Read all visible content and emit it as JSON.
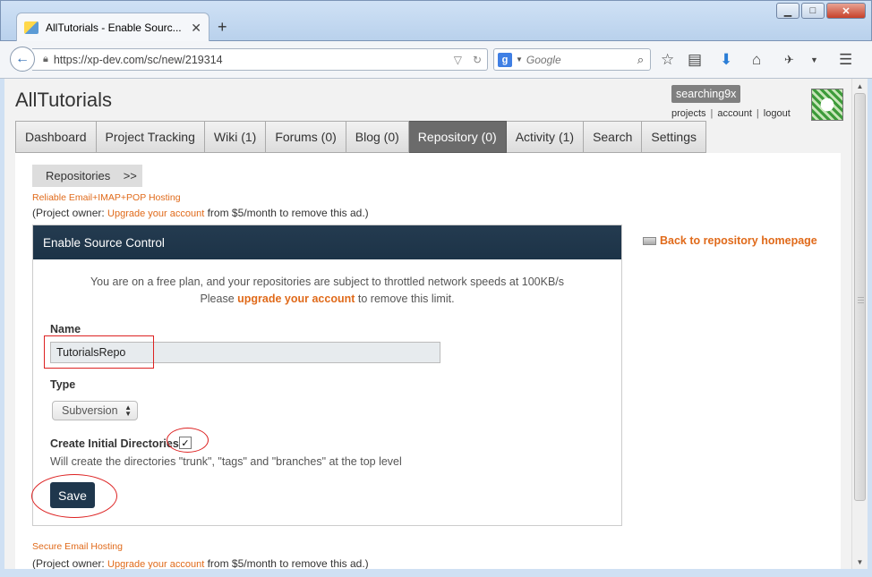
{
  "browser": {
    "tab_title": "AllTutorials - Enable Sourc...",
    "url": "https://xp-dev.com/sc/new/219314",
    "search_placeholder": "Google",
    "search_engine_letter": "g"
  },
  "site": {
    "title": "AllTutorials",
    "username": "searching9x",
    "user_links": [
      "projects",
      "account",
      "logout"
    ]
  },
  "tabs": [
    {
      "label": "Dashboard",
      "active": false
    },
    {
      "label": "Project Tracking",
      "active": false
    },
    {
      "label": "Wiki (1)",
      "active": false
    },
    {
      "label": "Forums (0)",
      "active": false
    },
    {
      "label": "Blog (0)",
      "active": false
    },
    {
      "label": "Repository (0)",
      "active": true
    },
    {
      "label": "Activity (1)",
      "active": false
    },
    {
      "label": "Search",
      "active": false
    },
    {
      "label": "Settings",
      "active": false
    }
  ],
  "breadcrumb": "Repositories    >>",
  "ad_top": {
    "link": "Reliable Email+IMAP+POP Hosting",
    "prefix": "(Project owner: ",
    "upgrade": "Upgrade your account",
    "suffix": " from $5/month to remove this ad.)"
  },
  "panel": {
    "title": "Enable Source Control",
    "notice_line1": "You are on a free plan, and your repositories are subject to throttled network speeds at 100KB/s",
    "notice_prefix": "Please ",
    "notice_link": "upgrade your account",
    "notice_suffix": " to remove this limit.",
    "name_label": "Name",
    "name_value": "TutorialsRepo",
    "type_label": "Type",
    "type_value": "Subversion",
    "create_dirs_label": "Create Initial Directories",
    "create_dirs_checked": true,
    "create_dirs_help": "Will create the directories \"trunk\", \"tags\" and \"branches\" at the top level",
    "save_label": "Save"
  },
  "back_link": "Back to repository homepage",
  "ad_bottom": {
    "link": "Secure Email Hosting",
    "prefix": "(Project owner: ",
    "upgrade": "Upgrade your account",
    "suffix": " from $5/month to remove this ad.)"
  },
  "colors": {
    "accent_orange": "#e06a1a",
    "panel_header": "#1f374d",
    "active_tab": "#6b6b6b",
    "annotation_red": "#dd2222"
  }
}
